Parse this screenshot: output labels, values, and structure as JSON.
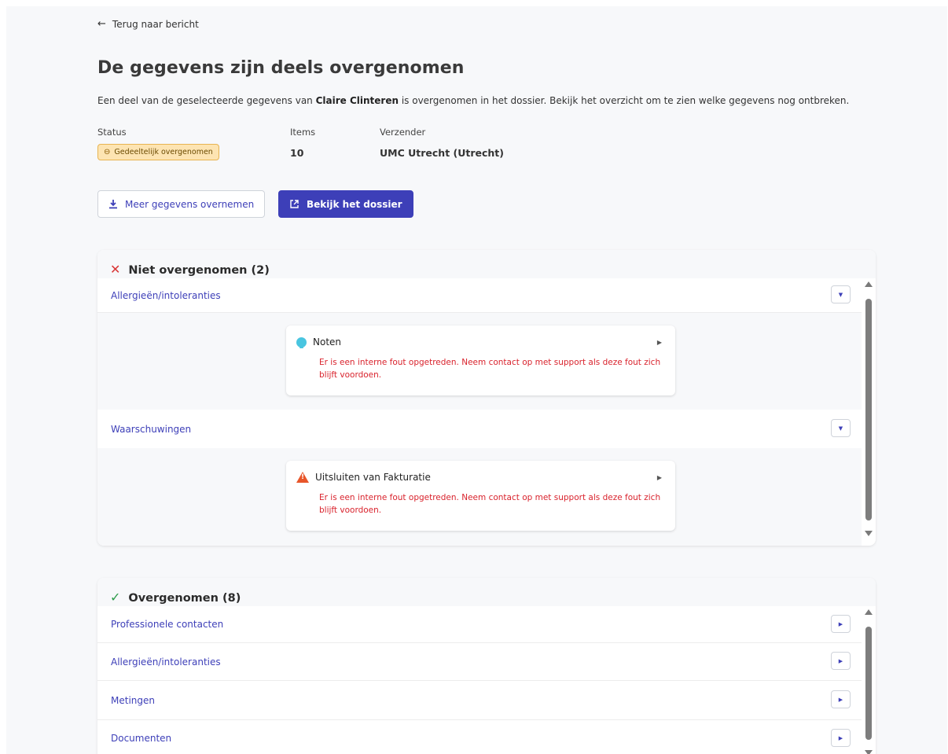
{
  "nav": {
    "back_label": "Terug naar bericht"
  },
  "header": {
    "title": "De gegevens zijn deels overgenomen",
    "intro_prefix": "Een deel van de geselecteerde gegevens van ",
    "patient_name": "Claire Clinteren",
    "intro_suffix": " is overgenomen in het dossier. Bekijk het overzicht om te zien welke gegevens nog ontbreken."
  },
  "meta": {
    "status_label": "Status",
    "status_value": "Gedeeltelijk overgenomen",
    "items_label": "Items",
    "items_value": "10",
    "sender_label": "Verzender",
    "sender_value": "UMC Utrecht (Utrecht)"
  },
  "actions": {
    "import_more_label": "Meer gegevens overnemen",
    "view_dossier_label": "Bekijk het dossier"
  },
  "not_imported": {
    "title": "Niet overgenomen (2)",
    "sections": [
      {
        "label": "Allergieën/intoleranties",
        "item": {
          "icon": "lightbulb-icon",
          "title": "Noten",
          "error": "Er is een interne fout opgetreden. Neem contact op met support als deze fout zich blijft voordoen."
        }
      },
      {
        "label": "Waarschuwingen",
        "item": {
          "icon": "warning-icon",
          "title": "Uitsluiten van Fakturatie",
          "error": "Er is een interne fout opgetreden. Neem contact op met support als deze fout zich blijft voordoen."
        }
      }
    ]
  },
  "imported": {
    "title": "Overgenomen (8)",
    "sections": [
      {
        "label": "Professionele contacten"
      },
      {
        "label": "Allergieën/intoleranties"
      },
      {
        "label": "Metingen"
      },
      {
        "label": "Documenten"
      }
    ]
  },
  "colors": {
    "accent": "#3d3fb8",
    "error": "#d9232d",
    "success": "#2e9c4b",
    "warning_badge_bg": "#fde4b2"
  }
}
